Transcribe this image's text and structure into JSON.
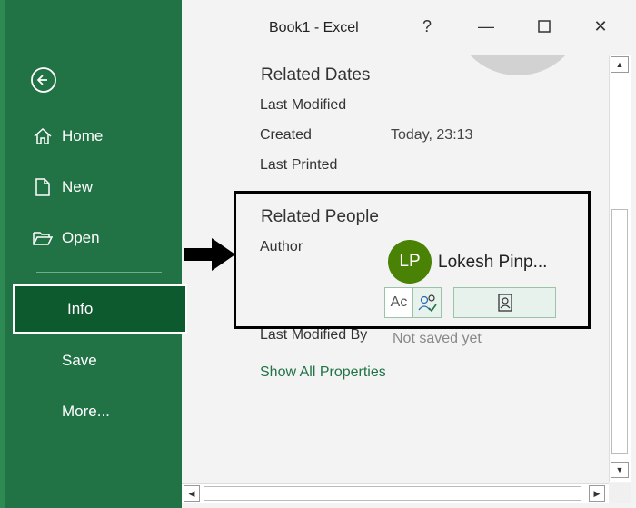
{
  "window": {
    "title": "Book1  -  Excel",
    "help_label": "?",
    "minimize_label": "—",
    "close_label": "✕"
  },
  "sidebar": {
    "back_icon": "back-arrow-icon",
    "items": [
      {
        "label": "Home",
        "icon": "home-icon"
      },
      {
        "label": "New",
        "icon": "new-document-icon"
      },
      {
        "label": "Open",
        "icon": "folder-open-icon"
      },
      {
        "label": "Info"
      },
      {
        "label": "Save"
      },
      {
        "label": "More..."
      }
    ],
    "active": "Info"
  },
  "related_dates": {
    "title": "Related Dates",
    "last_modified_label": "Last Modified",
    "created_label": "Created",
    "created_value": "Today, 23:13",
    "last_printed_label": "Last Printed"
  },
  "related_people": {
    "title": "Related People",
    "author_label": "Author",
    "author_initials": "LP",
    "author_name": "Lokesh Pinp...",
    "add_author_label": "Ac",
    "last_modified_by_label": "Last Modified By",
    "last_modified_by_value": "Not saved yet"
  },
  "show_all_properties": "Show All Properties",
  "colors": {
    "sidebar_bg": "#217346",
    "active_item_bg": "#0e5a2f",
    "avatar_bg": "#498205",
    "link": "#217346"
  }
}
